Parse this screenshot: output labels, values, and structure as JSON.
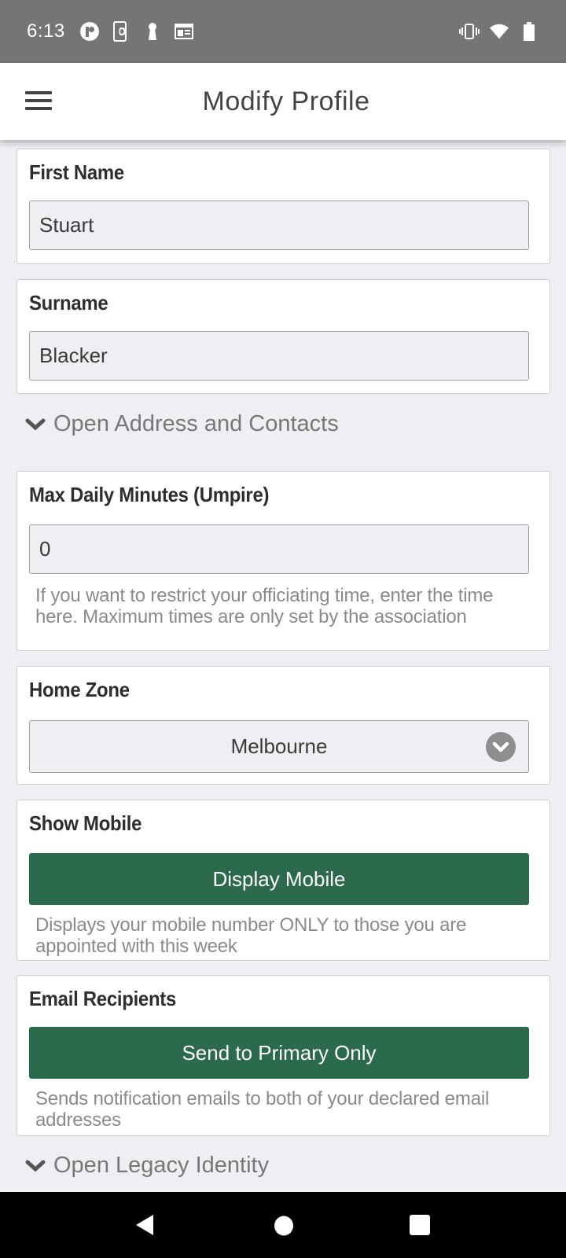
{
  "status_bar": {
    "time": "6:13",
    "left_icons": [
      "app-notification-icon",
      "phone-sync-icon",
      "keyhole-icon",
      "calendar-news-icon"
    ],
    "right_icons": [
      "vibrate-icon",
      "wifi-icon",
      "battery-icon"
    ]
  },
  "app_bar": {
    "menu_icon": "hamburger-menu-icon",
    "title": "Modify Profile"
  },
  "form": {
    "first_name": {
      "label": "First Name",
      "value": "Stuart"
    },
    "surname": {
      "label": "Surname",
      "value": "Blacker"
    },
    "address_expander": {
      "icon": "chevron-down-icon",
      "label": "Open Address and Contacts"
    },
    "max_daily_minutes": {
      "label": "Max Daily Minutes (Umpire)",
      "value": "0",
      "help": "If you want to restrict your officiating time, enter the time here.  Maximum times are only set by the association"
    },
    "home_zone": {
      "label": "Home Zone",
      "selected": "Melbourne",
      "icon": "chevron-circle-down-icon"
    },
    "show_mobile": {
      "label": "Show Mobile",
      "button_label": "Display Mobile",
      "help": "Displays your mobile number ONLY to those you are appointed with this week"
    },
    "email_recipients": {
      "label": "Email Recipients",
      "button_label": "Send to  Primary Only",
      "help": "Sends notification emails to both of your declared email addresses"
    },
    "legacy_expander": {
      "icon": "chevron-down-icon",
      "label": "Open Legacy Identity"
    }
  },
  "colors": {
    "accent_green": "#2b6a4c",
    "status_bar": "#757575",
    "page_background": "#efeff3"
  },
  "nav_bar": {
    "buttons": [
      "back-icon",
      "home-icon",
      "recents-icon"
    ]
  }
}
